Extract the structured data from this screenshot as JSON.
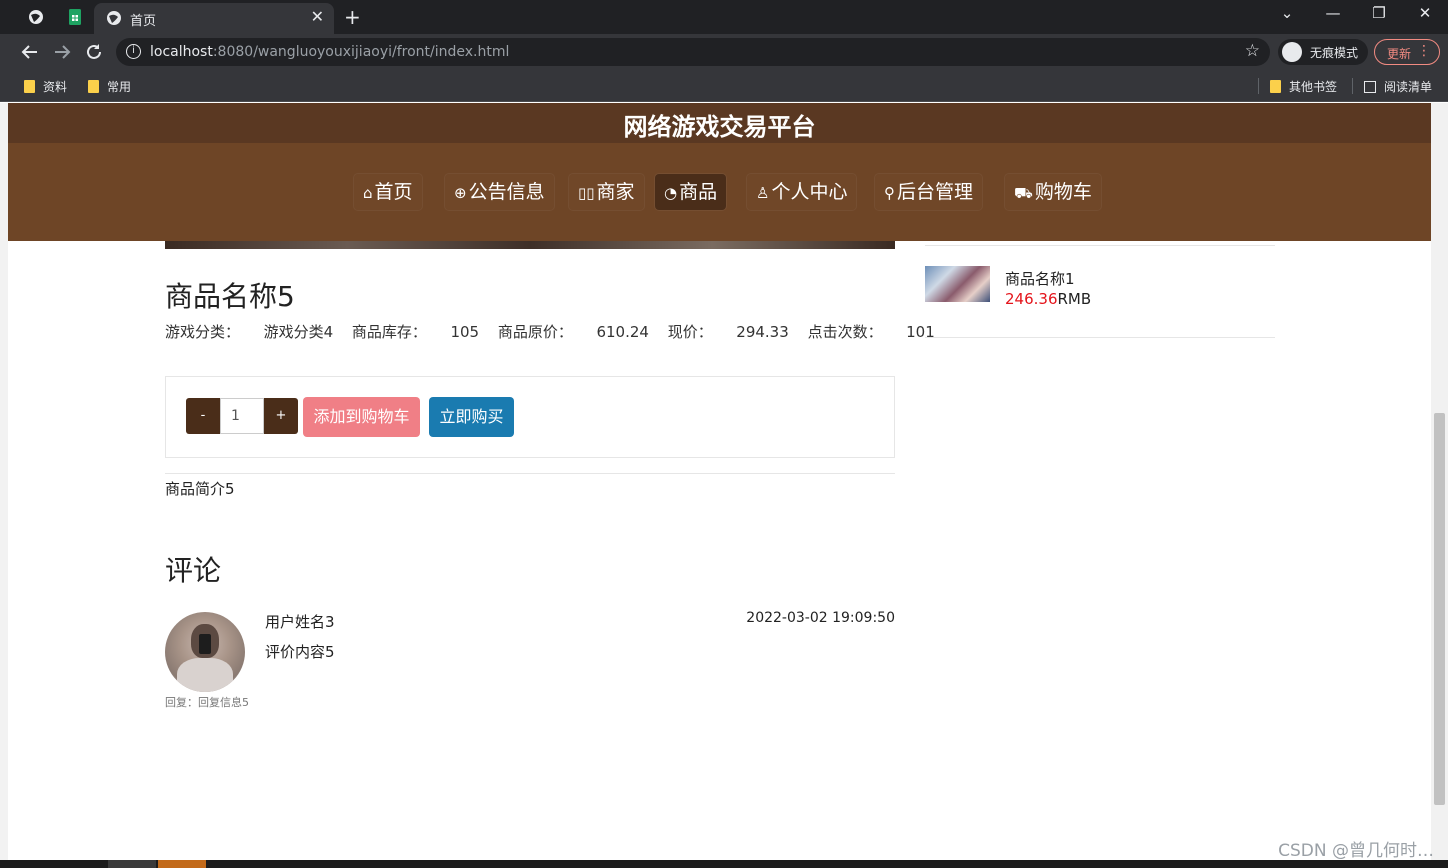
{
  "browser": {
    "active_tab_title": "首页",
    "tab_close": "✕",
    "new_tab": "+",
    "window_controls": [
      "⌄",
      "—",
      "❐",
      "✕"
    ],
    "url_host": "localhost",
    "url_rest": ":8080/wangluoyouxijiaoyi/front/index.html",
    "incognito_label": "无痕模式",
    "update_label": "更新",
    "bookmarks": [
      "资料",
      "常用"
    ],
    "other_bookmarks": "其他书签",
    "reading_list": "阅读清单"
  },
  "site": {
    "title": "网络游戏交易平台",
    "nav": [
      {
        "icon": "⌂",
        "label": "首页"
      },
      {
        "icon": "⊕",
        "label": "公告信息"
      },
      {
        "icon": "▯▯",
        "label": "商家"
      },
      {
        "icon": "◔",
        "label": "商品"
      },
      {
        "icon": "♙",
        "label": "个人中心"
      },
      {
        "icon": "⚲",
        "label": "后台管理"
      },
      {
        "icon": "⛟",
        "label": "购物车"
      }
    ]
  },
  "product": {
    "name": "商品名称5",
    "category_label": "游戏分类：",
    "category_value": "游戏分类4",
    "stock_label": "商品库存：",
    "stock_value": "105",
    "original_price_label": "商品原价：",
    "original_price_value": "610.24",
    "price_label": "现价：",
    "price_value": "294.33",
    "clicks_label": "点击次数：",
    "clicks_value": "101",
    "quantity": "1",
    "minus": "-",
    "plus": "+",
    "add_to_cart": "添加到购物车",
    "buy_now": "立即购买",
    "intro": "商品简介5"
  },
  "comments": {
    "heading": "评论",
    "items": [
      {
        "user": "用户姓名3",
        "content": "评价内容5",
        "time": "2022-03-02 19:09:50",
        "reply": "回复：回复信息5"
      }
    ]
  },
  "sidebar": {
    "items": [
      {
        "name": "商品名称1",
        "price": "246.36",
        "unit": "RMB"
      }
    ]
  },
  "watermark": "CSDN @曾几何时…"
}
